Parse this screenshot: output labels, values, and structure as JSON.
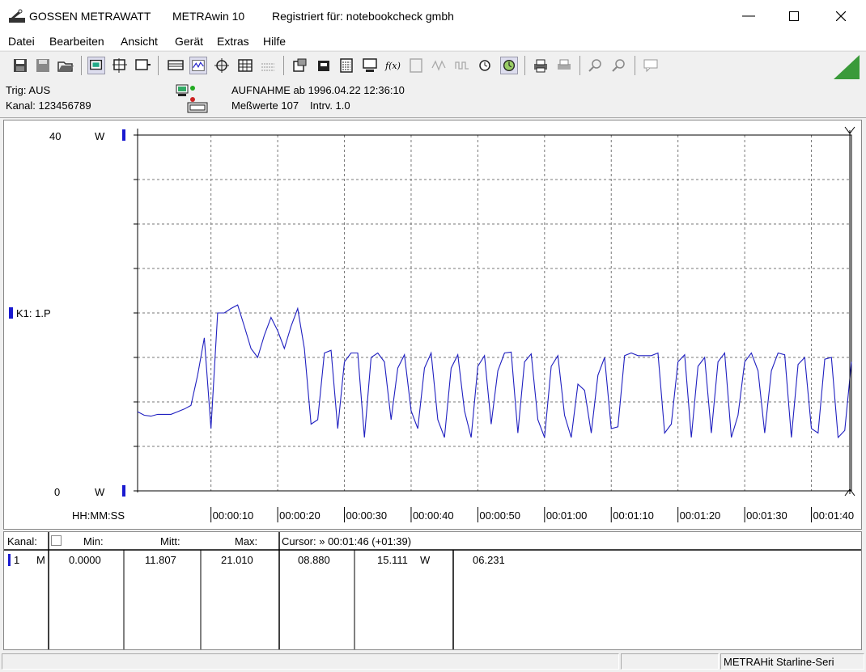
{
  "titlebar": {
    "brand": "GOSSEN METRAWATT",
    "app": "METRAwin 10",
    "registration": "Registriert für: notebookcheck gmbh"
  },
  "menu": [
    {
      "label": "Datei"
    },
    {
      "label": "Bearbeiten"
    },
    {
      "label": "Ansicht"
    },
    {
      "label": "Gerät"
    },
    {
      "label": "Extras"
    },
    {
      "label": "Hilfe"
    }
  ],
  "info": {
    "trigger": "Trig: AUS",
    "channel": "Kanal: 123456789",
    "recording": "AUFNAHME ab 1996.04.22 12:36:10",
    "measurements": "Meßwerte 107",
    "interval": "Intrv. 1.0"
  },
  "plot": {
    "y_max_label": "40",
    "y_min_label": "0",
    "y_unit": "W",
    "channel_label": "K1: 1.P",
    "time_format": "HH:MM:SS",
    "x_ticks": [
      "00:00:10",
      "00:00:20",
      "00:00:30",
      "00:00:40",
      "00:00:50",
      "00:01:00",
      "00:01:10",
      "00:01:20",
      "00:01:30",
      "00:01:40"
    ],
    "line_color": "#2020c0"
  },
  "chart_data": {
    "type": "line",
    "ylabel": "W",
    "ylim": [
      0,
      40
    ],
    "xlim": [
      0,
      107
    ],
    "x_unit": "seconds",
    "series": [
      {
        "name": "K1: 1.P",
        "points": [
          [
            0,
            8.9
          ],
          [
            1,
            8.5
          ],
          [
            2,
            8.4
          ],
          [
            3,
            8.6
          ],
          [
            4,
            8.6
          ],
          [
            5,
            8.6
          ],
          [
            6,
            8.9
          ],
          [
            7,
            9.2
          ],
          [
            8,
            9.6
          ],
          [
            9,
            13.0
          ],
          [
            10,
            17.2
          ],
          [
            11,
            7.0
          ],
          [
            12,
            20.0
          ],
          [
            13,
            20.0
          ],
          [
            14,
            20.5
          ],
          [
            15,
            20.9
          ],
          [
            16,
            18.5
          ],
          [
            17,
            16.0
          ],
          [
            18,
            15.0
          ],
          [
            19,
            17.5
          ],
          [
            20,
            19.5
          ],
          [
            21,
            18.0
          ],
          [
            22,
            16.0
          ],
          [
            23,
            18.5
          ],
          [
            24,
            20.5
          ],
          [
            25,
            16.0
          ],
          [
            26,
            7.5
          ],
          [
            27,
            8.0
          ],
          [
            28,
            15.5
          ],
          [
            29,
            15.8
          ],
          [
            30,
            7.0
          ],
          [
            31,
            14.5
          ],
          [
            32,
            15.5
          ],
          [
            33,
            15.5
          ],
          [
            34,
            6.0
          ],
          [
            35,
            15.0
          ],
          [
            36,
            15.5
          ],
          [
            37,
            14.5
          ],
          [
            38,
            8.0
          ],
          [
            39,
            13.8
          ],
          [
            40,
            15.3
          ],
          [
            41,
            9.0
          ],
          [
            42,
            7.0
          ],
          [
            43,
            13.8
          ],
          [
            44,
            15.5
          ],
          [
            45,
            8.0
          ],
          [
            46,
            6.0
          ],
          [
            47,
            13.8
          ],
          [
            48,
            15.3
          ],
          [
            49,
            9.0
          ],
          [
            50,
            6.0
          ],
          [
            51,
            14.0
          ],
          [
            52,
            15.2
          ],
          [
            53,
            7.5
          ],
          [
            54,
            13.5
          ],
          [
            55,
            15.5
          ],
          [
            56,
            15.6
          ],
          [
            57,
            6.5
          ],
          [
            58,
            14.5
          ],
          [
            59,
            15.4
          ],
          [
            60,
            8.0
          ],
          [
            61,
            6.0
          ],
          [
            62,
            14.0
          ],
          [
            63,
            15.2
          ],
          [
            64,
            8.5
          ],
          [
            65,
            6.0
          ],
          [
            66,
            12.0
          ],
          [
            67,
            11.3
          ],
          [
            68,
            6.5
          ],
          [
            69,
            13.0
          ],
          [
            70,
            15.0
          ],
          [
            71,
            7.0
          ],
          [
            72,
            7.2
          ],
          [
            73,
            15.2
          ],
          [
            74,
            15.5
          ],
          [
            75,
            15.2
          ],
          [
            76,
            15.2
          ],
          [
            77,
            15.2
          ],
          [
            78,
            15.5
          ],
          [
            79,
            6.5
          ],
          [
            80,
            7.5
          ],
          [
            81,
            14.5
          ],
          [
            82,
            15.3
          ],
          [
            83,
            6.0
          ],
          [
            84,
            14.0
          ],
          [
            85,
            15.0
          ],
          [
            86,
            6.5
          ],
          [
            87,
            14.5
          ],
          [
            88,
            15.5
          ],
          [
            89,
            6.0
          ],
          [
            90,
            8.5
          ],
          [
            91,
            14.5
          ],
          [
            92,
            15.5
          ],
          [
            93,
            13.5
          ],
          [
            94,
            6.5
          ],
          [
            95,
            13.5
          ],
          [
            96,
            15.5
          ],
          [
            97,
            15.3
          ],
          [
            98,
            6.0
          ],
          [
            99,
            14.2
          ],
          [
            100,
            15.0
          ],
          [
            101,
            7.0
          ],
          [
            102,
            6.5
          ],
          [
            103,
            14.8
          ],
          [
            104,
            15.0
          ],
          [
            105,
            6.0
          ],
          [
            106,
            6.8
          ],
          [
            107,
            14.5
          ]
        ]
      }
    ]
  },
  "stats": {
    "h_kanal": "Kanal:",
    "h_min": "Min:",
    "h_mitt": "Mitt:",
    "h_max": "Max:",
    "h_cursor": "Cursor: » 00:01:46 (+01:39)",
    "row_channel": "1",
    "row_mode": "M",
    "min": "0.0000",
    "mitt": "11.807",
    "max": "21.010",
    "cursor_val1": "08.880",
    "cursor_val2": "15.111",
    "cursor_unit": "W",
    "cursor_val3": "06.231"
  },
  "status": {
    "device": "METRAHit Starline-Seri"
  }
}
